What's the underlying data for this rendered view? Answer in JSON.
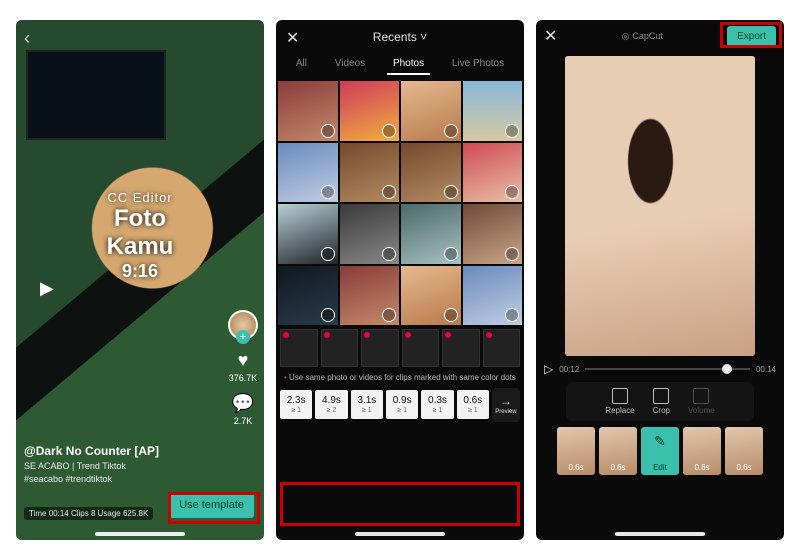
{
  "panel1": {
    "overlay": {
      "line1": "CC Editor",
      "line2": "Foto Kamu",
      "line3": "9:16"
    },
    "likes": "376.7K",
    "comments": "2.7K",
    "handle": "@Dark No Counter [AP]",
    "subtitle": "SE ACABO | Trend Tiktok",
    "hashtags": "#seacabo #trendtiktok",
    "clip_info": "Time 00:14 Clips 8 Usage 625.8K",
    "use_template": "Use template"
  },
  "panel2": {
    "album": "Recents",
    "chevron": "˅",
    "tabs": [
      "All",
      "Videos",
      "Photos",
      "Live Photos"
    ],
    "active_tab": 2,
    "hint": "Use same photo or videos for clips marked with same color dots",
    "durations": [
      "2.3s",
      "4.9s",
      "3.1s",
      "0.9s",
      "0.3s",
      "0.6s"
    ],
    "dur_subs": [
      "≥ 1",
      "≥ 2",
      "≥ 1",
      "≥ 1",
      "≥ 1",
      "≥ 1"
    ],
    "preview_btn": "Preview"
  },
  "panel3": {
    "brand": "CapCut",
    "export": "Export",
    "time_left": "00:12",
    "time_right": "00:14",
    "tools": [
      "Replace",
      "Crop",
      "Volume"
    ],
    "clip_durations": [
      "0.6s",
      "0.6s",
      "Edit",
      "0.6s",
      "0.6s"
    ],
    "selected_clip": 2
  }
}
